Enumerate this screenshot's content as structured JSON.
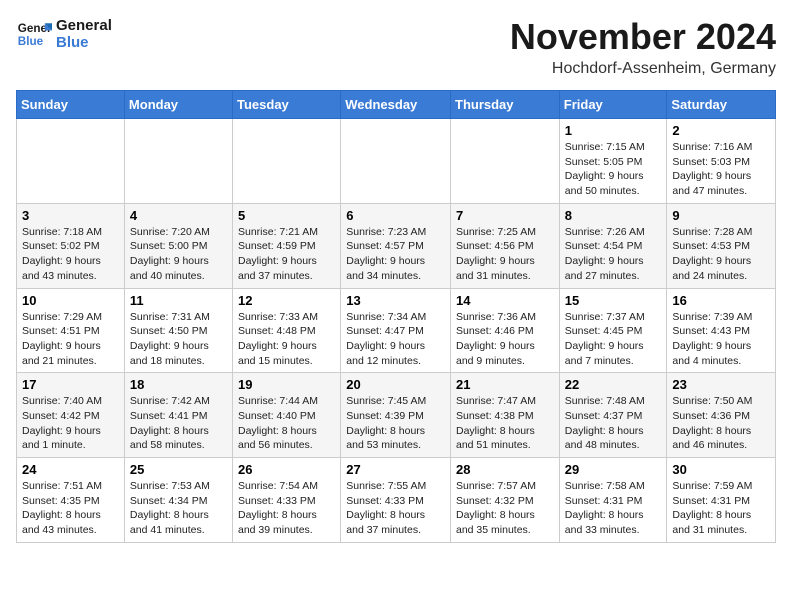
{
  "header": {
    "logo_text_general": "General",
    "logo_text_blue": "Blue",
    "month": "November 2024",
    "location": "Hochdorf-Assenheim, Germany"
  },
  "weekdays": [
    "Sunday",
    "Monday",
    "Tuesday",
    "Wednesday",
    "Thursday",
    "Friday",
    "Saturday"
  ],
  "weeks": [
    [
      {
        "day": "",
        "info": ""
      },
      {
        "day": "",
        "info": ""
      },
      {
        "day": "",
        "info": ""
      },
      {
        "day": "",
        "info": ""
      },
      {
        "day": "",
        "info": ""
      },
      {
        "day": "1",
        "info": "Sunrise: 7:15 AM\nSunset: 5:05 PM\nDaylight: 9 hours and 50 minutes."
      },
      {
        "day": "2",
        "info": "Sunrise: 7:16 AM\nSunset: 5:03 PM\nDaylight: 9 hours and 47 minutes."
      }
    ],
    [
      {
        "day": "3",
        "info": "Sunrise: 7:18 AM\nSunset: 5:02 PM\nDaylight: 9 hours and 43 minutes."
      },
      {
        "day": "4",
        "info": "Sunrise: 7:20 AM\nSunset: 5:00 PM\nDaylight: 9 hours and 40 minutes."
      },
      {
        "day": "5",
        "info": "Sunrise: 7:21 AM\nSunset: 4:59 PM\nDaylight: 9 hours and 37 minutes."
      },
      {
        "day": "6",
        "info": "Sunrise: 7:23 AM\nSunset: 4:57 PM\nDaylight: 9 hours and 34 minutes."
      },
      {
        "day": "7",
        "info": "Sunrise: 7:25 AM\nSunset: 4:56 PM\nDaylight: 9 hours and 31 minutes."
      },
      {
        "day": "8",
        "info": "Sunrise: 7:26 AM\nSunset: 4:54 PM\nDaylight: 9 hours and 27 minutes."
      },
      {
        "day": "9",
        "info": "Sunrise: 7:28 AM\nSunset: 4:53 PM\nDaylight: 9 hours and 24 minutes."
      }
    ],
    [
      {
        "day": "10",
        "info": "Sunrise: 7:29 AM\nSunset: 4:51 PM\nDaylight: 9 hours and 21 minutes."
      },
      {
        "day": "11",
        "info": "Sunrise: 7:31 AM\nSunset: 4:50 PM\nDaylight: 9 hours and 18 minutes."
      },
      {
        "day": "12",
        "info": "Sunrise: 7:33 AM\nSunset: 4:48 PM\nDaylight: 9 hours and 15 minutes."
      },
      {
        "day": "13",
        "info": "Sunrise: 7:34 AM\nSunset: 4:47 PM\nDaylight: 9 hours and 12 minutes."
      },
      {
        "day": "14",
        "info": "Sunrise: 7:36 AM\nSunset: 4:46 PM\nDaylight: 9 hours and 9 minutes."
      },
      {
        "day": "15",
        "info": "Sunrise: 7:37 AM\nSunset: 4:45 PM\nDaylight: 9 hours and 7 minutes."
      },
      {
        "day": "16",
        "info": "Sunrise: 7:39 AM\nSunset: 4:43 PM\nDaylight: 9 hours and 4 minutes."
      }
    ],
    [
      {
        "day": "17",
        "info": "Sunrise: 7:40 AM\nSunset: 4:42 PM\nDaylight: 9 hours and 1 minute."
      },
      {
        "day": "18",
        "info": "Sunrise: 7:42 AM\nSunset: 4:41 PM\nDaylight: 8 hours and 58 minutes."
      },
      {
        "day": "19",
        "info": "Sunrise: 7:44 AM\nSunset: 4:40 PM\nDaylight: 8 hours and 56 minutes."
      },
      {
        "day": "20",
        "info": "Sunrise: 7:45 AM\nSunset: 4:39 PM\nDaylight: 8 hours and 53 minutes."
      },
      {
        "day": "21",
        "info": "Sunrise: 7:47 AM\nSunset: 4:38 PM\nDaylight: 8 hours and 51 minutes."
      },
      {
        "day": "22",
        "info": "Sunrise: 7:48 AM\nSunset: 4:37 PM\nDaylight: 8 hours and 48 minutes."
      },
      {
        "day": "23",
        "info": "Sunrise: 7:50 AM\nSunset: 4:36 PM\nDaylight: 8 hours and 46 minutes."
      }
    ],
    [
      {
        "day": "24",
        "info": "Sunrise: 7:51 AM\nSunset: 4:35 PM\nDaylight: 8 hours and 43 minutes."
      },
      {
        "day": "25",
        "info": "Sunrise: 7:53 AM\nSunset: 4:34 PM\nDaylight: 8 hours and 41 minutes."
      },
      {
        "day": "26",
        "info": "Sunrise: 7:54 AM\nSunset: 4:33 PM\nDaylight: 8 hours and 39 minutes."
      },
      {
        "day": "27",
        "info": "Sunrise: 7:55 AM\nSunset: 4:33 PM\nDaylight: 8 hours and 37 minutes."
      },
      {
        "day": "28",
        "info": "Sunrise: 7:57 AM\nSunset: 4:32 PM\nDaylight: 8 hours and 35 minutes."
      },
      {
        "day": "29",
        "info": "Sunrise: 7:58 AM\nSunset: 4:31 PM\nDaylight: 8 hours and 33 minutes."
      },
      {
        "day": "30",
        "info": "Sunrise: 7:59 AM\nSunset: 4:31 PM\nDaylight: 8 hours and 31 minutes."
      }
    ]
  ]
}
